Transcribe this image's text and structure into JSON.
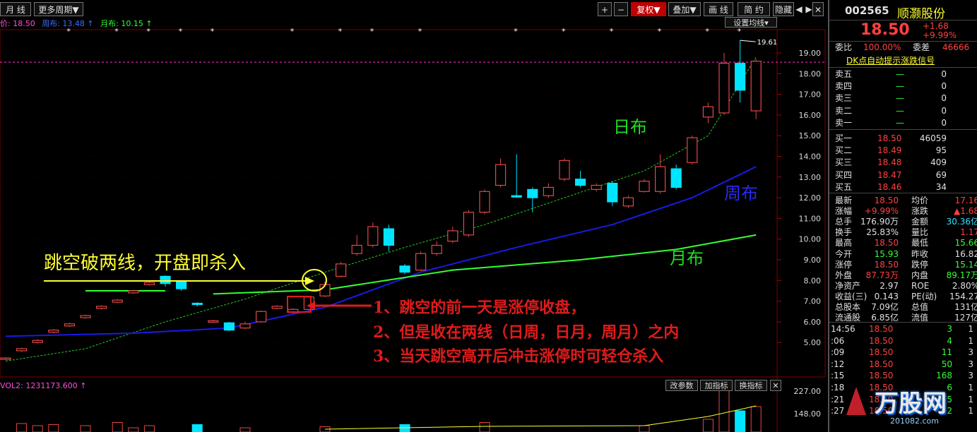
{
  "toolbar": {
    "period_label": "月 线",
    "more_periods": "更多周期",
    "zoom_in": "+",
    "zoom_out": "−",
    "fq_label": "复权",
    "overlay_label": "叠加",
    "draw_label": "画 线",
    "profile_label": "简 约",
    "hide_label": "隐藏",
    "prev": "◀",
    "next": "▶",
    "close": "✕",
    "settings_label": "设置均线"
  },
  "legend": {
    "price_label": "价: 18.50",
    "week_label": "周布: 13.48",
    "month_label": "月布: 10.15"
  },
  "colors": {
    "up": "#e64646",
    "down": "#00e5ff",
    "day_line": "#22cc22",
    "week_line": "#1a1ae6",
    "month_line": "#33ff33",
    "grid": "#7a0000"
  },
  "chart_data": {
    "type": "candlestick",
    "y_axis_ticks": [
      "19.00",
      "18.00",
      "17.00",
      "16.00",
      "15.00",
      "14.00",
      "13.00",
      "12.00",
      "11.00",
      "10.00",
      "9.00",
      "8.00",
      "7.00",
      "6.00",
      "5.00"
    ],
    "ylim": [
      4.5,
      19.8
    ],
    "max_label": "19.61",
    "vol_ticks": [
      "227.00",
      "148.00"
    ],
    "vol_title": "VOL2: 1231173.600",
    "candles": [
      [
        4.2,
        4.25,
        4.15,
        4.3
      ],
      [
        4.6,
        4.7,
        4.55,
        4.75
      ],
      [
        5.0,
        5.1,
        4.95,
        5.15
      ],
      [
        5.5,
        5.6,
        5.45,
        5.65
      ],
      [
        5.8,
        5.9,
        5.75,
        5.95
      ],
      [
        6.2,
        6.3,
        6.15,
        6.35
      ],
      [
        6.65,
        6.75,
        6.6,
        6.8
      ],
      [
        6.95,
        7.05,
        6.9,
        7.1
      ],
      [
        7.4,
        7.5,
        7.35,
        7.55
      ],
      [
        7.8,
        7.9,
        7.75,
        7.95
      ],
      [
        8.2,
        7.85,
        7.7,
        8.25
      ],
      [
        7.95,
        7.6,
        7.5,
        8.0
      ],
      [
        6.9,
        6.85,
        6.75,
        6.95
      ],
      [
        6.0,
        6.05,
        5.95,
        6.1
      ],
      [
        5.95,
        5.6,
        5.55,
        6.0
      ],
      [
        5.7,
        5.9,
        5.65,
        6.0
      ],
      [
        6.0,
        6.5,
        5.95,
        6.55
      ],
      [
        6.65,
        6.75,
        6.6,
        6.8
      ],
      [
        6.45,
        6.6,
        6.4,
        6.65
      ],
      [
        6.6,
        7.2,
        6.55,
        7.25
      ],
      [
        7.25,
        7.8,
        7.2,
        7.95
      ],
      [
        8.2,
        8.8,
        8.15,
        8.9
      ],
      [
        9.3,
        9.7,
        9.2,
        10.2
      ],
      [
        9.7,
        10.6,
        9.6,
        10.8
      ],
      [
        10.5,
        9.7,
        9.4,
        10.7
      ],
      [
        8.7,
        8.4,
        8.3,
        8.8
      ],
      [
        8.5,
        9.3,
        8.45,
        9.4
      ],
      [
        9.3,
        9.7,
        9.2,
        9.9
      ],
      [
        9.9,
        10.4,
        9.8,
        10.6
      ],
      [
        10.2,
        11.3,
        10.1,
        11.4
      ],
      [
        11.3,
        12.3,
        11.2,
        12.4
      ],
      [
        12.6,
        13.6,
        12.5,
        13.9
      ],
      [
        12.1,
        12.05,
        12.0,
        14.1
      ],
      [
        12.4,
        12.0,
        11.3,
        12.5
      ],
      [
        12.1,
        12.5,
        12.0,
        12.7
      ],
      [
        12.9,
        13.8,
        12.8,
        13.9
      ],
      [
        12.9,
        12.6,
        12.5,
        13.3
      ],
      [
        12.4,
        12.6,
        12.3,
        12.7
      ],
      [
        12.7,
        11.8,
        11.6,
        12.8
      ],
      [
        11.6,
        12.0,
        11.5,
        12.1
      ],
      [
        12.3,
        12.8,
        12.25,
        12.9
      ],
      [
        12.3,
        13.5,
        12.2,
        14.1
      ],
      [
        13.4,
        12.5,
        12.4,
        13.6
      ],
      [
        13.7,
        14.9,
        13.6,
        15.0
      ],
      [
        15.9,
        16.4,
        15.6,
        16.6
      ],
      [
        16.1,
        18.5,
        16.0,
        19.0
      ],
      [
        18.5,
        17.2,
        16.6,
        19.61
      ],
      [
        16.2,
        18.6,
        15.8,
        18.7
      ]
    ],
    "day_line": [
      [
        0,
        4.1
      ],
      [
        5,
        4.7
      ],
      [
        10,
        6.0
      ],
      [
        15,
        7.1
      ],
      [
        20,
        8.4
      ],
      [
        25,
        9.6
      ],
      [
        30,
        10.7
      ],
      [
        35,
        12.0
      ],
      [
        40,
        13.3
      ],
      [
        44,
        15.0
      ],
      [
        47,
        18.8
      ]
    ],
    "week_line": [
      [
        0,
        5.3
      ],
      [
        8,
        5.45
      ],
      [
        14,
        5.7
      ],
      [
        20,
        6.7
      ],
      [
        26,
        8.4
      ],
      [
        32,
        9.6
      ],
      [
        38,
        10.7
      ],
      [
        43,
        12.0
      ],
      [
        47,
        13.5
      ]
    ],
    "month_line": [
      [
        5,
        7.5
      ],
      [
        10,
        7.5
      ]
    ],
    "month_line2": [
      [
        13,
        7.35
      ],
      [
        20,
        7.55
      ],
      [
        28,
        8.5
      ],
      [
        36,
        9.0
      ],
      [
        42,
        9.5
      ],
      [
        47,
        10.2
      ]
    ],
    "volumes": [
      [
        1,
        40
      ],
      [
        2,
        30
      ],
      [
        3,
        35
      ],
      [
        5,
        30
      ],
      [
        7,
        45
      ],
      [
        8,
        20
      ],
      [
        9,
        30
      ],
      [
        12,
        35
      ],
      [
        15,
        20
      ],
      [
        20,
        25
      ],
      [
        25,
        35
      ],
      [
        30,
        45
      ],
      [
        40,
        30
      ],
      [
        44,
        60
      ],
      [
        45,
        230
      ],
      [
        46,
        100
      ],
      [
        47,
        120
      ]
    ]
  },
  "annotations": {
    "strategy_title": "跳空破两线，开盘即杀入",
    "point1": "1、跳空的前一天是涨停收盘，",
    "point2": "2、但是收在两线（日周，日月，周月）之内",
    "point3": "3、当天跳空高开后冲击涨停时可轻仓杀入",
    "day_label": "日布",
    "week_label": "周布",
    "month_label": "月布"
  },
  "vol_buttons": {
    "params": "改参数",
    "add": "加指标",
    "swap": "换指标",
    "close": "✕"
  },
  "quote": {
    "code": "002565",
    "name": "顺灏股份",
    "price": "18.50",
    "change": "+1.68",
    "change_pct": "+9.99%",
    "ratio_label": "委比",
    "ratio_value": "100.00%",
    "diff_label": "委差",
    "diff_value": "46666",
    "signal_title": "DK点自动提示涨跌信号",
    "sells": [
      {
        "label": "卖五",
        "price": "—",
        "vol": "0"
      },
      {
        "label": "卖四",
        "price": "—",
        "vol": "0"
      },
      {
        "label": "卖三",
        "price": "—",
        "vol": "0"
      },
      {
        "label": "卖二",
        "price": "—",
        "vol": "0"
      },
      {
        "label": "卖一",
        "price": "—",
        "vol": "0"
      }
    ],
    "buys": [
      {
        "label": "买一",
        "price": "18.50",
        "vol": "46059"
      },
      {
        "label": "买二",
        "price": "18.49",
        "vol": "95"
      },
      {
        "label": "买三",
        "price": "18.48",
        "vol": "409"
      },
      {
        "label": "买四",
        "price": "18.47",
        "vol": "69"
      },
      {
        "label": "买五",
        "price": "18.46",
        "vol": "34"
      }
    ],
    "stats": [
      {
        "l1": "最新",
        "v1": "18.50",
        "l2": "均价",
        "v2": "17.16",
        "c1": "#ff4040",
        "c2": "#ff4040"
      },
      {
        "l1": "涨幅",
        "v1": "+9.99%",
        "l2": "涨跌",
        "v2": "▲1.68",
        "c1": "#ff4040",
        "c2": "#ff4040"
      },
      {
        "l1": "总手",
        "v1": "176.90万",
        "l2": "金额",
        "v2": "30.36亿",
        "c1": "#e0e0e0",
        "c2": "#33e0ff"
      },
      {
        "l1": "换手",
        "v1": "25.83%",
        "l2": "量比",
        "v2": "1.17",
        "c1": "#e0e0e0",
        "c2": "#ff4040"
      },
      {
        "l1": "最高",
        "v1": "18.50",
        "l2": "最低",
        "v2": "15.66",
        "c1": "#ff4040",
        "c2": "#33ff33"
      },
      {
        "l1": "今开",
        "v1": "15.93",
        "l2": "昨收",
        "v2": "16.82",
        "c1": "#33ff33",
        "c2": "#e0e0e0"
      },
      {
        "l1": "涨停",
        "v1": "18.50",
        "l2": "跌停",
        "v2": "15.14",
        "c1": "#ff4040",
        "c2": "#33ff33"
      },
      {
        "l1": "外盘",
        "v1": "87.73万",
        "l2": "内盘",
        "v2": "89.17万",
        "c1": "#ff4040",
        "c2": "#33ff33"
      },
      {
        "l1": "净资产",
        "v1": "2.97",
        "l2": "ROE",
        "v2": "2.80%",
        "c1": "#e0e0e0",
        "c2": "#e0e0e0"
      },
      {
        "l1": "收益(三)",
        "v1": "0.143",
        "l2": "PE(动)",
        "v2": "154.27",
        "c1": "#e0e0e0",
        "c2": "#e0e0e0"
      },
      {
        "l1": "总股本",
        "v1": "7.09亿",
        "l2": "总值",
        "v2": "131亿",
        "c1": "#e0e0e0",
        "c2": "#e0e0e0"
      },
      {
        "l1": "流通股",
        "v1": "6.85亿",
        "l2": "流值",
        "v2": "127亿",
        "c1": "#e0e0e0",
        "c2": "#e0e0e0"
      }
    ],
    "ticks": [
      {
        "t": "14:56",
        "p": "18.50",
        "v": "3",
        "f": "1"
      },
      {
        "t": ":06",
        "p": "18.50",
        "v": "4",
        "f": "1"
      },
      {
        "t": ":09",
        "p": "18.50",
        "v": "11",
        "f": "3"
      },
      {
        "t": ":12",
        "p": "18.50",
        "v": "50",
        "f": "3"
      },
      {
        "t": ":15",
        "p": "18.50",
        "v": "168",
        "f": "3"
      },
      {
        "t": ":18",
        "p": "18.50",
        "v": "6",
        "f": "1"
      },
      {
        "t": ":21",
        "p": "18.50",
        "v": "5",
        "f": "1"
      },
      {
        "t": ":27",
        "p": "18.50",
        "v": "2",
        "f": "1"
      }
    ],
    "watermark": "万股网",
    "watermark_url": "201082.com"
  }
}
